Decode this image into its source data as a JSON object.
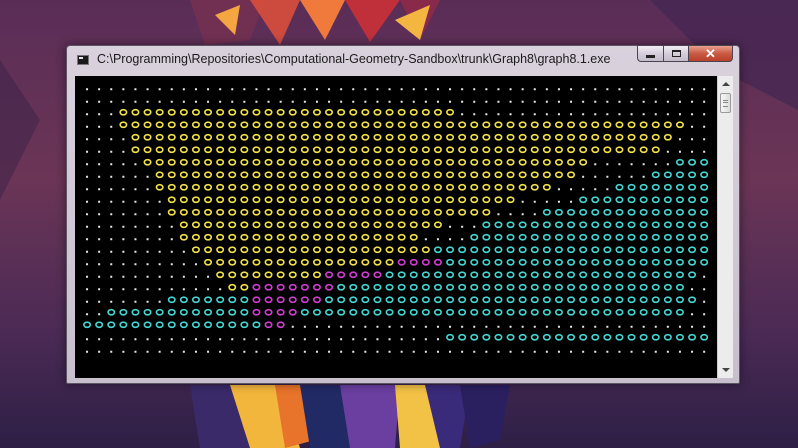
{
  "window": {
    "title": "C:\\Programming\\Repositories\\Computational-Geometry-Sandbox\\trunk\\Graph8\\graph8.1.exe",
    "icon": "console-app-icon",
    "controls": {
      "minimize": "minimize-icon",
      "maximize": "maximize-icon",
      "close_label": "✕"
    }
  },
  "console": {
    "background": "#000000",
    "grid": {
      "rows": 22,
      "cols": 53
    },
    "colors": {
      ".": "#e8e8e8",
      "Y": "#f2e24a",
      "C": "#45d6d2",
      "M": "#d23cd2"
    },
    "glyphs": {
      ".": ".",
      "Y": "o",
      "C": "o",
      "M": "o"
    },
    "lines": [
      ".....................................................",
      ".....................................................",
      "...YYYYYYYYYYYYYYYYYYYYYYYYYYYY......................",
      "...YYYYYYYYYYYYYYYYYYYYYYYYYYYYYYYYYYYYYYYYYYYYYYY....",
      "....YYYYYYYYYYYYYYYYYYYYYYYYYYYYYYYYYYYYYYYYYYYYY.....",
      "....YYYYYYYYYYYYYYYYYYYYYYYYYYYYYYYYYYYYYYYYYYYY......",
      ".....YYYYYYYYYYYYYYYYYYYYYYYYYYYYYYYYYYYYY.......CCCC..",
      "......YYYYYYYYYYYYYYYYYYYYYYYYYYYYYYYYYYY......CCCCC...",
      "......YYYYYYYYYYYYYYYYYYYYYYYYYYYYYYYYY.....CCCCCCCCC..",
      ".......YYYYYYYYYYYYYYYYYYYYYYYYYYYYY.....CCCCCCCCCCCCC..",
      ".......YYYYYYYYYYYYYYYYYYYYYYYYYYY....CCCCCCCCCCCCCCCC..",
      "........YYYYYYYYYYYYYYYYYYYYYY...CCCCCCCCCCCCCCCCCCCC..",
      "........YYYYYYYYYYYYYYYYYYYY....CCCCCCCCCCCCCCCCCCCC...",
      ".........YYYYYYYYYYYYYYYYYYYYCCCCCCCCCCCCCCCCCCCCCCC...",
      "..........YYYYYYYYYYYYYYYYMMMMCCCCCCCCCCCCCCCCCCCCCC....",
      "...........YYYYYYYYYMMMMMCCCCCCCCCCCCCCCCCCCCCCCCCC....",
      "............YYMMMMMMMCCCCCCCCCCCCCCCCCCCCCCCCCCCCC.....",
      ".......CCCCCCCMMMMMMCCCCCCCCCCCCCCCCCCCCCCCCCCCCCCC.....",
      "..CCCCCCCCCCCCMMMMCCCCCCCCCCCCCCCCCCCCCCCCCCCCCCCC......",
      "CCCCCCCCCCCCCCCMM........................................",
      "..............................CCCCCCCCCCCCCCCCCCCCCC.....",
      "....................................................."
    ]
  }
}
